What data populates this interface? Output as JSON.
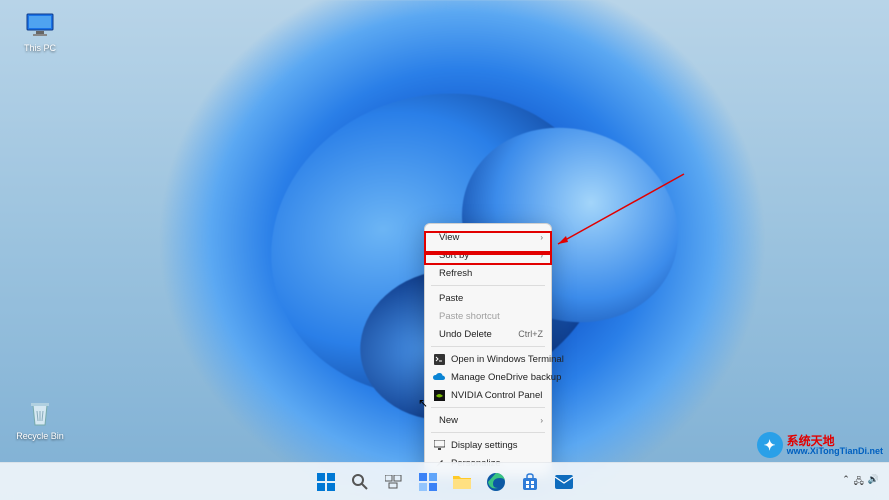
{
  "desktop_icons": {
    "this_pc_label": "This PC",
    "recycle_label": "Recycle Bin"
  },
  "context_menu": {
    "view": "View",
    "sort_by": "Sort by",
    "refresh": "Refresh",
    "paste": "Paste",
    "paste_shortcut": "Paste shortcut",
    "undo_delete": "Undo Delete",
    "undo_shortcut": "Ctrl+Z",
    "open_terminal": "Open in Windows Terminal",
    "onedrive_backup": "Manage OneDrive backup",
    "nvidia_panel": "NVIDIA Control Panel",
    "new": "New",
    "display_settings": "Display settings",
    "personalize": "Personalize"
  },
  "watermark": {
    "line1": "系统天地",
    "line2": "www.XiTongTianDi.net"
  },
  "taskbar": {
    "icons": {
      "start": "start-icon",
      "search": "search-icon",
      "taskview": "task-view-icon",
      "widgets": "widgets-icon",
      "explorer": "file-explorer-icon",
      "edge": "edge-icon",
      "store": "store-icon",
      "mail": "mail-icon"
    }
  }
}
